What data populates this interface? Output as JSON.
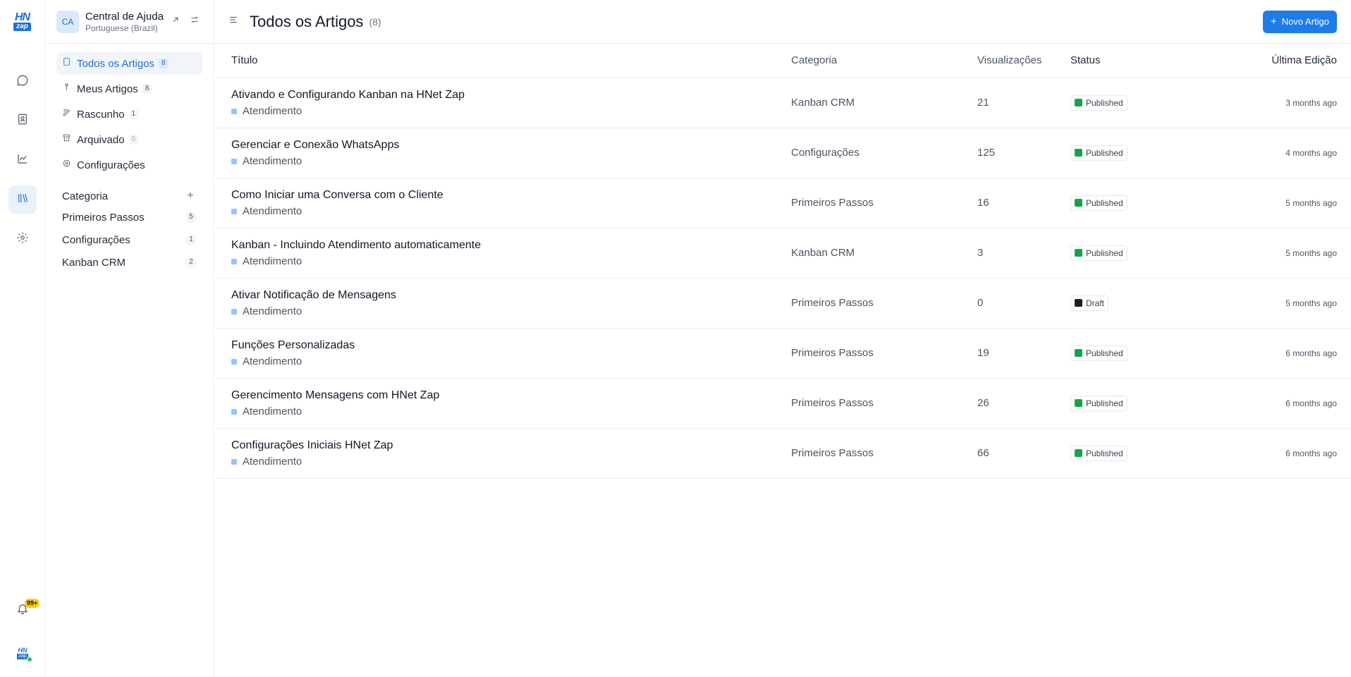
{
  "rail": {
    "logo_top": "HN",
    "logo_bottom": "zap",
    "notifications_badge": "99+",
    "avatar_top": "HN",
    "avatar_bottom": "zap"
  },
  "portal": {
    "initials": "CA",
    "name": "Central de Ajuda",
    "locale": "Portuguese (Brazil)"
  },
  "nav": [
    {
      "label": "Todos os Artigos",
      "count": "8",
      "icon": "document-icon"
    },
    {
      "label": "Meus Artigos",
      "count": "8",
      "icon": "pen-icon"
    },
    {
      "label": "Rascunho",
      "count": "1",
      "icon": "draft-icon"
    },
    {
      "label": "Arquivado",
      "count": "0",
      "icon": "archive-icon"
    },
    {
      "label": "Configurações",
      "count": null,
      "icon": "gear-icon"
    }
  ],
  "categories": {
    "title": "Categoria",
    "add_label": "+",
    "items": [
      {
        "label": "Primeiros Passos",
        "count": "5"
      },
      {
        "label": "Configurações",
        "count": "1"
      },
      {
        "label": "Kanban CRM",
        "count": "2"
      }
    ]
  },
  "header": {
    "title": "Todos os Artigos",
    "count": "(8)",
    "new_button": "Novo Artigo"
  },
  "table": {
    "columns": [
      "Título",
      "Categoria",
      "Visualizações",
      "Status",
      "Última Edição"
    ],
    "rows": [
      {
        "title": "Ativando e Configurando Kanban na HNet Zap",
        "author": "Atendimento",
        "category": "Kanban CRM",
        "views": "21",
        "status": "Published",
        "edited": "3 months ago"
      },
      {
        "title": "Gerenciar e Conexão WhatsApps",
        "author": "Atendimento",
        "category": "Configurações",
        "views": "125",
        "status": "Published",
        "edited": "4 months ago"
      },
      {
        "title": "Como Iniciar uma Conversa com o Cliente",
        "author": "Atendimento",
        "category": "Primeiros Passos",
        "views": "16",
        "status": "Published",
        "edited": "5 months ago"
      },
      {
        "title": "Kanban - Incluindo Atendimento automaticamente",
        "author": "Atendimento",
        "category": "Kanban CRM",
        "views": "3",
        "status": "Published",
        "edited": "5 months ago"
      },
      {
        "title": "Ativar Notificação de Mensagens",
        "author": "Atendimento",
        "category": "Primeiros Passos",
        "views": "0",
        "status": "Draft",
        "edited": "5 months ago"
      },
      {
        "title": "Funções Personalizadas",
        "author": "Atendimento",
        "category": "Primeiros Passos",
        "views": "19",
        "status": "Published",
        "edited": "6 months ago"
      },
      {
        "title": "Gerencimento Mensagens com HNet Zap",
        "author": "Atendimento",
        "category": "Primeiros Passos",
        "views": "26",
        "status": "Published",
        "edited": "6 months ago"
      },
      {
        "title": "Configurações Iniciais HNet Zap",
        "author": "Atendimento",
        "category": "Primeiros Passos",
        "views": "66",
        "status": "Published",
        "edited": "6 months ago"
      }
    ]
  },
  "colors": {
    "accent": "#1e7bea",
    "published": "#16a34a",
    "draft": "#1f1f1f"
  }
}
